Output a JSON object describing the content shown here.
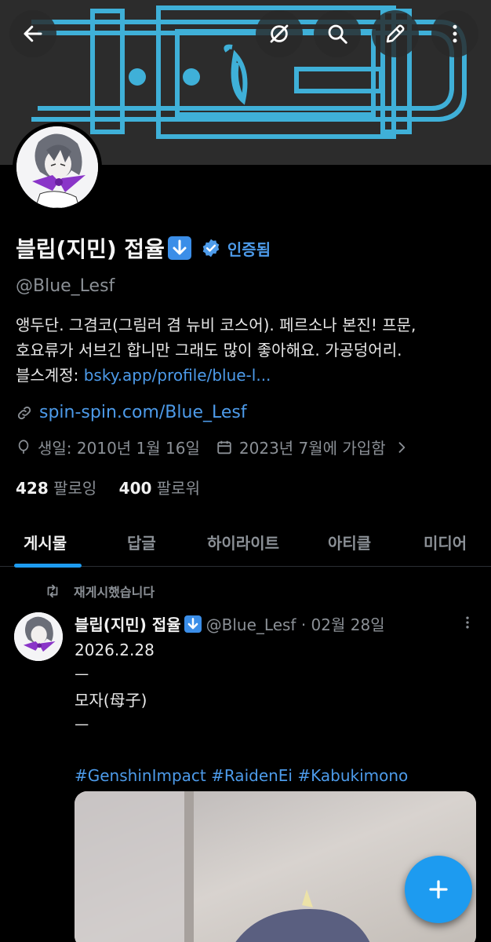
{
  "header": {
    "back_icon": "arrow-left-icon",
    "actions": [
      "grok-icon",
      "search-icon",
      "edit-icon",
      "more-icon"
    ]
  },
  "profile": {
    "name": "블립(지민) 접율",
    "verified_label": "인증됨",
    "handle": "@Blue_Lesf",
    "bio_line1": "앵두단. 그겸코(그림러 겸 뉴비 코스어). 페르소나 본진! 프문,",
    "bio_line2": "호요류가 서브긴 합니만 그래도 많이 좋아해요.  가공덩어리.",
    "bio_line3_prefix": "블스계정: ",
    "bio_line3_link": "bsky.app/profile/blue-l...",
    "website": "spin-spin.com/Blue_Lesf",
    "birthday": "생일: 2010년 1월 16일",
    "joined": "2023년 7월에 가입함",
    "following_count": "428",
    "following_label": "팔로잉",
    "followers_count": "400",
    "followers_label": "팔로워"
  },
  "tabs": [
    "게시물",
    "답글",
    "하이라이트",
    "아티클",
    "미디어"
  ],
  "post": {
    "repost_label": "재게시했습니다",
    "author_name": "블립(지민) 접율",
    "author_meta": "@Blue_Lesf · 02월 28일",
    "line1": "2026.2.28",
    "line2": "ㅡ",
    "line3": "모자(母子)",
    "line4": "ㅡ",
    "hashtags": "#GenshinImpact #RaidenEi #Kabukimono"
  },
  "colors": {
    "accent": "#1d9bf0",
    "link": "#4d9bea",
    "banner_line": "#3fb0d8"
  }
}
